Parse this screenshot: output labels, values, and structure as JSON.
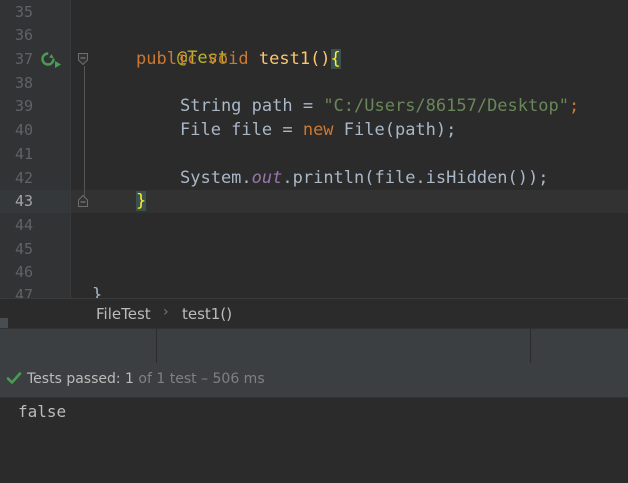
{
  "editor": {
    "line_numbers": [
      "35",
      "36",
      "37",
      "38",
      "39",
      "40",
      "41",
      "42",
      "43",
      "44",
      "45",
      "46",
      "47"
    ],
    "current_line": "43",
    "lines": {
      "annotation": "@Test",
      "method": {
        "kw_public": "public",
        "kw_void": "void",
        "name": "test1",
        "parens": "()",
        "brace": "{"
      },
      "path_decl": {
        "type": "String",
        "name": " path = ",
        "value": "\"C:/Users/86157/Desktop\"",
        "end": ";"
      },
      "file_decl": {
        "type": "File file = ",
        "kw_new": "new",
        "ctor": " File(path);"
      },
      "println": {
        "cls": "System.",
        "field": "out",
        "call": ".println(file.isHidden());"
      },
      "close_brace": "}",
      "class_close": "}"
    }
  },
  "breadcrumb": {
    "items": [
      "FileTest",
      "test1()"
    ],
    "separator": "›"
  },
  "run": {
    "status_main": "Tests passed: ",
    "passed": "1",
    "status_rest": " of 1 test – 506 ms",
    "output": "false",
    "icons": {
      "status": "check-icon",
      "gutter": "run-test-icon"
    },
    "colors": {
      "pass": "#499c54",
      "background": "#2b2b2b"
    }
  }
}
